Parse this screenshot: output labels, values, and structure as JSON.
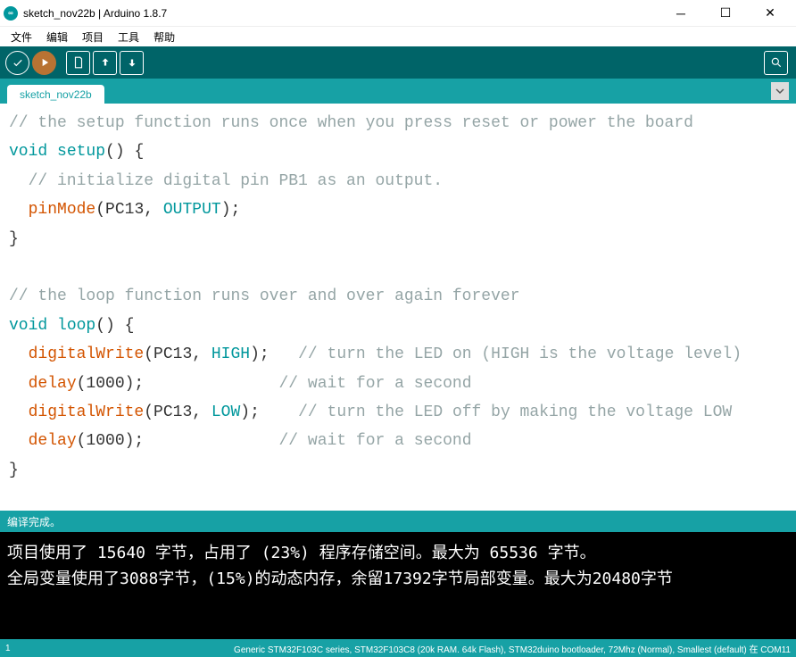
{
  "window": {
    "title": "sketch_nov22b | Arduino 1.8.7"
  },
  "menu": {
    "file": "文件",
    "edit": "编辑",
    "sketch": "项目",
    "tools": "工具",
    "help": "帮助"
  },
  "tabs": {
    "active": "sketch_nov22b"
  },
  "code": {
    "line1_comment": "// the setup function runs once when you press reset or power the board",
    "line2_void": "void",
    "line2_setup": "setup",
    "line2_rest": "() {",
    "line3_comment": "  // initialize digital pin PB1 as an output.",
    "line4_indent": "  ",
    "line4_pinMode": "pinMode",
    "line4_open": "(",
    "line4_pin": "PC13",
    "line4_comma": ", ",
    "line4_output": "OUTPUT",
    "line4_close": ");",
    "line5": "}",
    "line7_comment": "// the loop function runs over and over again forever",
    "line8_void": "void",
    "line8_loop": "loop",
    "line8_rest": "() {",
    "line9_indent": "  ",
    "line9_dw": "digitalWrite",
    "line9_open": "(",
    "line9_pin": "PC13",
    "line9_comma": ", ",
    "line9_high": "HIGH",
    "line9_close": ");",
    "line9_spaces": "   ",
    "line9_comment": "// turn the LED on (HIGH is the voltage level)",
    "line10_indent": "  ",
    "line10_delay": "delay",
    "line10_args": "(1000);",
    "line10_spaces": "              ",
    "line10_comment": "// wait for a second",
    "line11_indent": "  ",
    "line11_dw": "digitalWrite",
    "line11_open": "(",
    "line11_pin": "PC13",
    "line11_comma": ", ",
    "line11_low": "LOW",
    "line11_close": ");",
    "line11_spaces": "    ",
    "line11_comment": "// turn the LED off by making the voltage LOW",
    "line12_indent": "  ",
    "line12_delay": "delay",
    "line12_args": "(1000);",
    "line12_spaces": "              ",
    "line12_comment": "// wait for a second",
    "line13": "}"
  },
  "status": {
    "compile_done": "编译完成。"
  },
  "console": {
    "line1": "项目使用了 15640 字节，占用了 (23%) 程序存储空间。最大为 65536 字节。",
    "line2": "全局变量使用了3088字节，(15%)的动态内存，余留17392字节局部变量。最大为20480字节"
  },
  "footer": {
    "line": "1",
    "board": "Generic STM32F103C series, STM32F103C8 (20k RAM. 64k Flash), STM32duino bootloader, 72Mhz (Normal), Smallest (default) 在 COM11"
  }
}
